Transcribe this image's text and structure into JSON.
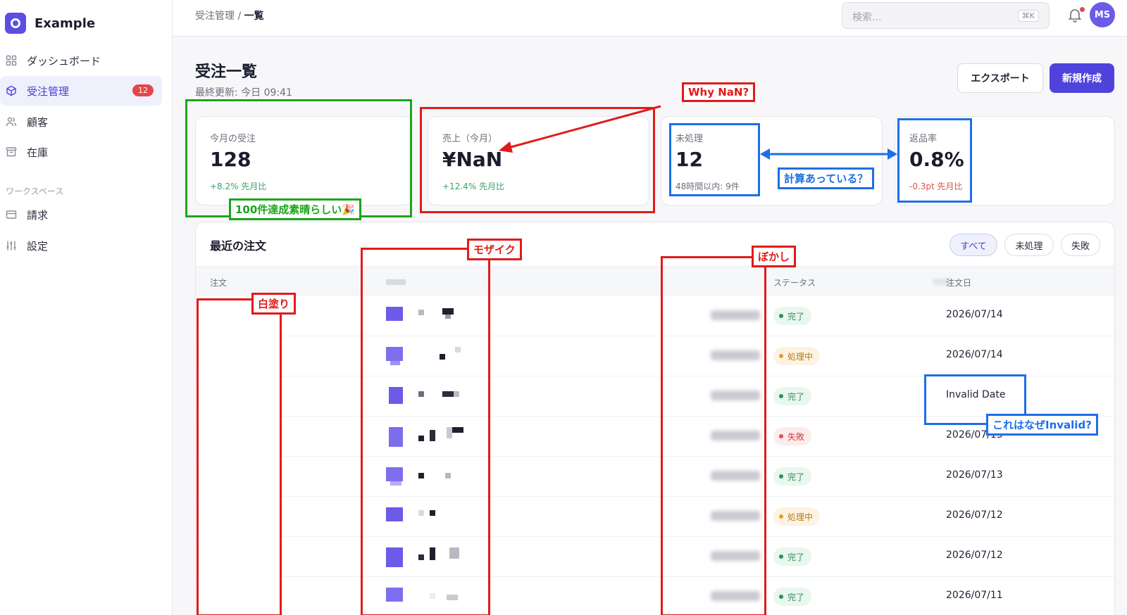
{
  "app": {
    "name": "Example"
  },
  "sidebar": {
    "items": [
      {
        "label": "ダッシュボード",
        "icon": "grid-icon"
      },
      {
        "label": "受注管理",
        "icon": "cube-icon",
        "badge": "12",
        "active": true
      },
      {
        "label": "顧客",
        "icon": "users-icon"
      },
      {
        "label": "在庫",
        "icon": "archive-icon"
      }
    ],
    "section_label": "ワークスペース",
    "section_items": [
      {
        "label": "請求",
        "icon": "credit-card-icon"
      },
      {
        "label": "設定",
        "icon": "sliders-icon"
      }
    ]
  },
  "topbar": {
    "breadcrumb_parent": "受注管理",
    "breadcrumb_sep": " / ",
    "breadcrumb_current": "一覧",
    "search_placeholder": "検索...",
    "search_shortcut": "⌘K",
    "avatar_initials": "MS"
  },
  "page": {
    "title": "受注一覧",
    "last_updated": "最終更新: 今日 09:41",
    "export_label": "エクスポート",
    "new_label": "新規作成"
  },
  "stats": [
    {
      "label": "今月の受注",
      "value": "128",
      "sub": "+8.2% 先月比",
      "tone": "green"
    },
    {
      "label": "売上（今月）",
      "value": "¥NaN",
      "sub": "+12.4% 先月比",
      "tone": "green"
    },
    {
      "label": "未処理",
      "value": "12",
      "sub": "48時間以内: 9件",
      "tone": "gray"
    },
    {
      "label": "返品率",
      "value": "0.8%",
      "sub": "-0.3pt 先月比",
      "tone": "red"
    }
  ],
  "orders": {
    "title": "最近の注文",
    "filters": [
      "すべて",
      "未処理",
      "失敗"
    ],
    "active_filter": "すべて",
    "columns": [
      "注文",
      "ステータス",
      "注文日"
    ],
    "rows": [
      {
        "status": "完了",
        "tone": "ok",
        "date": "2026/07/14"
      },
      {
        "status": "処理中",
        "tone": "proc",
        "date": "2026/07/14"
      },
      {
        "status": "完了",
        "tone": "ok",
        "date": "Invalid Date"
      },
      {
        "status": "失敗",
        "tone": "fail",
        "date": "2026/07/13"
      },
      {
        "status": "完了",
        "tone": "ok",
        "date": "2026/07/13"
      },
      {
        "status": "処理中",
        "tone": "proc",
        "date": "2026/07/12"
      },
      {
        "status": "完了",
        "tone": "ok",
        "date": "2026/07/12"
      },
      {
        "status": "完了",
        "tone": "ok",
        "date": "2026/07/11"
      }
    ]
  },
  "annotations": {
    "why_nan": "Why NaN?",
    "achievement": "100件達成素晴らしい🎉",
    "calc_check": "計算あっている？",
    "mosaic": "モザイク",
    "blur": "ぼかし",
    "whiteout": "白塗り",
    "invalid_q": "これはなぜInvalid?"
  }
}
